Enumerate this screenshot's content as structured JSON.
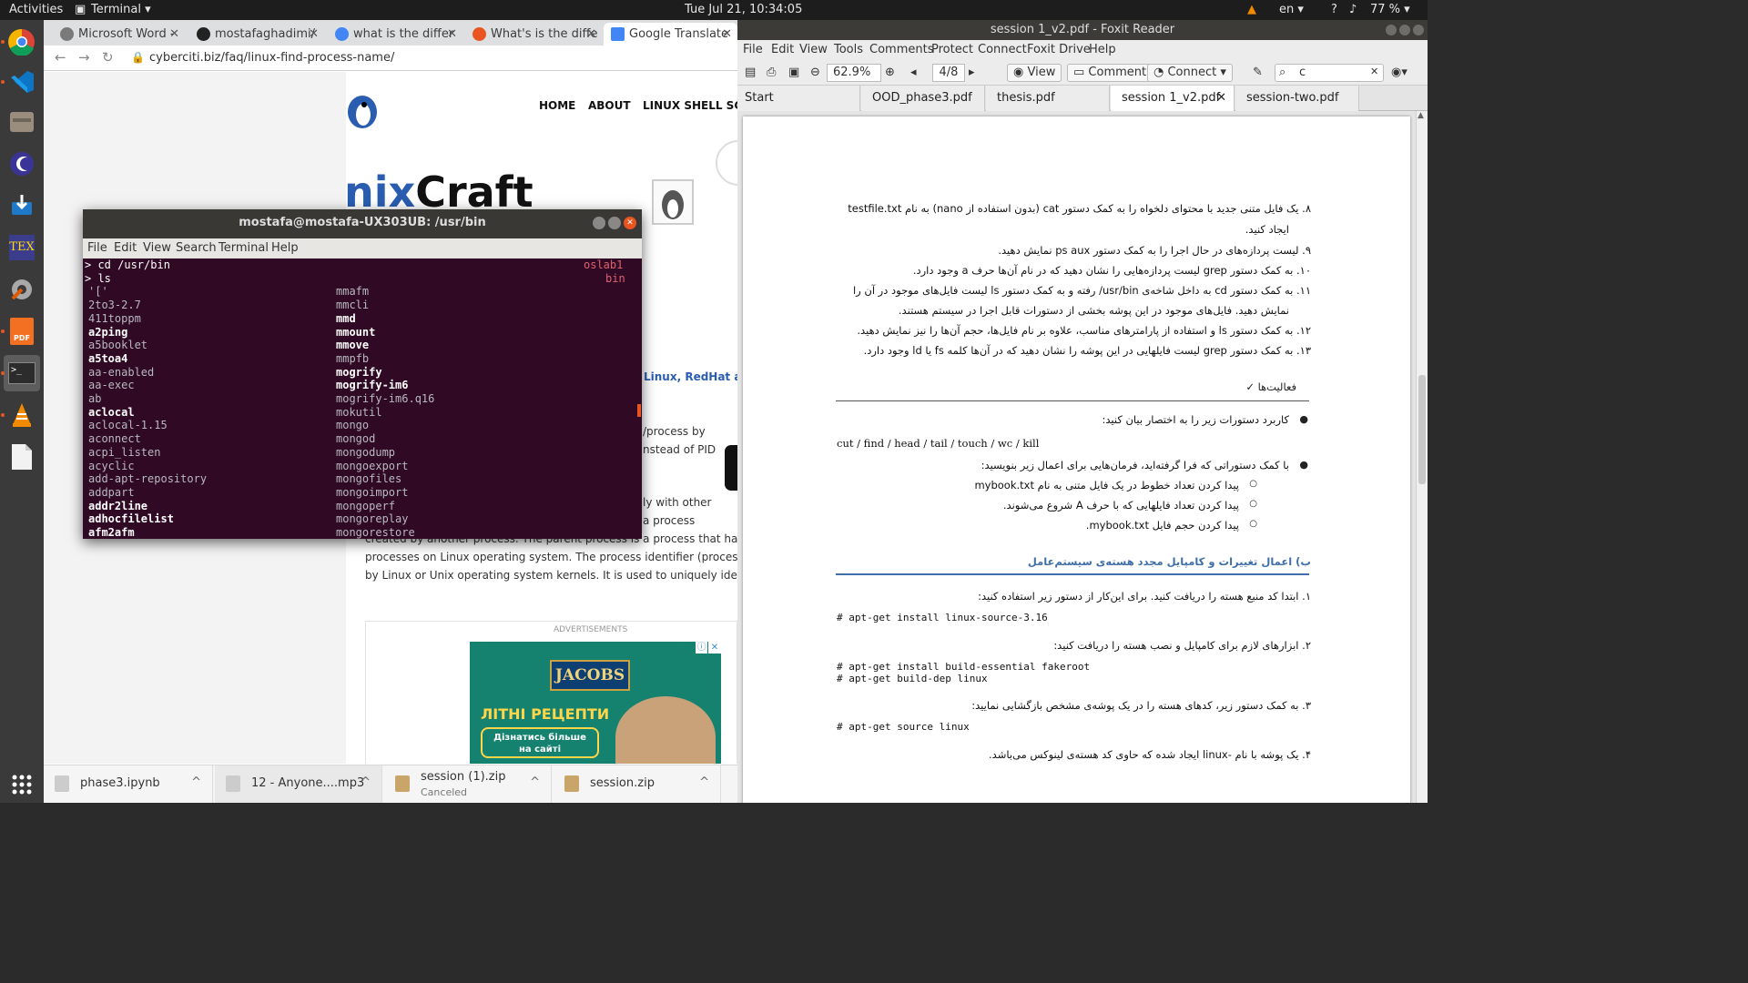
{
  "topbar": {
    "activities": "Activities",
    "app_menu": "Terminal ▾",
    "clock": "Tue Jul 21, 10:34:05",
    "lang": "en ▾",
    "battery": "77 % ▾",
    "help": "?"
  },
  "chrome": {
    "tabs": [
      {
        "label": "Microsoft Word - ",
        "color": "#7a7a7a"
      },
      {
        "label": "mostafaghadimi/",
        "color": "#222222"
      },
      {
        "label": "what is the differ",
        "color": "#4285f4"
      },
      {
        "label": "What's is the diffe",
        "color": "#e95420"
      },
      {
        "label": "Google Translate",
        "color": "#4285f4"
      }
    ],
    "url": "cyberciti.biz/faq/linux-find-process-name/",
    "nav": [
      "HOME",
      "ABOUT",
      "LINUX SHELL SCR"
    ],
    "site_logo_left": "nix",
    "site_logo_right": "Craft",
    "body_lines": [
      "Linux, RedHat and",
      "/process by",
      "nstead of PID",
      "ly with other",
      "a process",
      "created by another process. The parent process is a process that has created on",
      "processes on Linux operating system. The process identifier (process ID or PID)",
      "by Linux or Unix operating system kernels. It is used to uniquely identify an activ"
    ],
    "ads_label": "ADVERTISEMENTS",
    "ad": {
      "brand": "JACOBS",
      "headline": "ЛІТНІ РЕЦЕПТИ",
      "cta": "Дізнатись більше на сайті"
    },
    "downloads": [
      {
        "name": "phase3.ipynb",
        "sub": ""
      },
      {
        "name": "12 - Anyone....mp3",
        "sub": ""
      },
      {
        "name": "session (1).zip",
        "sub": "Canceled"
      },
      {
        "name": "session.zip",
        "sub": ""
      }
    ]
  },
  "terminal": {
    "title": "mostafa@mostafa-UX303UB: /usr/bin",
    "menu": [
      "File",
      "Edit",
      "View",
      "Search",
      "Terminal",
      "Help"
    ],
    "prompt1": "> cd /usr/bin",
    "prompt2": "> ls",
    "right_info1": "oslab1",
    "right_info2": "bin",
    "col1": [
      "'['",
      "2to3-2.7",
      "411toppm",
      "a2ping",
      "a5booklet",
      "a5toa4",
      "aa-enabled",
      "aa-exec",
      "ab",
      "aclocal",
      "aclocal-1.15",
      "aconnect",
      "acpi_listen",
      "acyclic",
      "add-apt-repository",
      "addpart",
      "addr2line",
      "adhocfilelist",
      "afm2afm"
    ],
    "col1_bold": [
      false,
      false,
      false,
      true,
      false,
      true,
      false,
      false,
      false,
      true,
      false,
      false,
      false,
      false,
      false,
      false,
      true,
      true,
      true
    ],
    "col2": [
      "mmafm",
      "mmcli",
      "mmd",
      "mmount",
      "mmove",
      "mmpfb",
      "mogrify",
      "mogrify-im6",
      "mogrify-im6.q16",
      "mokutil",
      "mongo",
      "mongod",
      "mongodump",
      "mongoexport",
      "mongofiles",
      "mongoimport",
      "mongoperf",
      "mongoreplay",
      "mongorestore"
    ],
    "col2_bold": [
      false,
      false,
      true,
      true,
      true,
      false,
      true,
      true,
      false,
      false,
      false,
      false,
      false,
      false,
      false,
      false,
      false,
      false,
      false
    ]
  },
  "foxit": {
    "title": "session 1_v2.pdf - Foxit Reader",
    "menu": [
      "File",
      "Edit",
      "View",
      "Tools",
      "Comments",
      "Protect",
      "Connect",
      "Foxit Drive",
      "Help"
    ],
    "zoom": "62.9%",
    "page": "4/8",
    "view_btn": "View",
    "comment_btn": "Comment",
    "connect_btn": "Connect",
    "search_value": "c",
    "tabs": [
      "Start",
      "OOD_phase3.pdf",
      "thesis.pdf",
      "session 1_v2.pdf",
      "session-two.pdf"
    ],
    "doc": {
      "items_a": [
        "۸. یک فایل متنی جدید با محتوای دلخواه را به کمک دستور cat (بدون استفاده از nano) به نام testfile.txt",
        "ایجاد کنید.",
        "۹. لیست پردازه‌های در حال اجرا را به کمک دستور ps aux نمایش دهید.",
        "۱۰. به کمک دستور grep لیست پردازه‌هایی را نشان دهید که در نام آن‌ها حرف a وجود دارد.",
        "۱۱. به کمک دستور cd به داخل شاخه‌ی usr/bin/ رفته و به کمک دستور ls لیست فایل‌های موجود در آن را",
        "نمایش دهید. فایل‌های موجود در این پوشه بخشی از دستورات قابل اجرا در سیستم هستند.",
        "۱۲. به کمک دستور ls و استفاده از پارامترهای مناسب، علاوه بر نام فایل‌ها، حجم آن‌ها را نیز نمایش دهید.",
        "۱۳. به کمک دستور grep لیست فایلهایی در این پوشه را نشان دهید که در آن‌ها کلمه fs یا ld وجود دارد."
      ],
      "activities_heading": "فعالیت‌ها ✓",
      "bullet1": "کاربرد دستورات زیر را به اختصار بیان کنید:",
      "commands": "cut / find / head / tail / touch / wc / kill",
      "bullet2": "با کمک دستوراتی که فرا گرفته‌اید، فرمان‌هایی برای اعمال زیر بنویسید:",
      "sub": [
        "پیدا کردن تعداد خطوط در یک فایل متنی به نام mybook.txt",
        "پیدا کردن تعداد فایلهایی که با حرف A شروع می‌شوند.",
        "پیدا کردن حجم فایل mybook.txt."
      ],
      "section_b": "ب) اعمال تغییرات و کامپایل مجدد هسته‌ی سیستم‌عامل",
      "step1": "۱. ابتدا کد منبع هسته را دریافت کنید. برای این‌کار از دستور زیر استفاده کنید:",
      "code1": "# apt-get install linux-source-3.16",
      "step2": "۲. ابزارهای لازم برای کامپایل و نصب هسته را دریافت کنید:",
      "code2a": "# apt-get install build-essential fakeroot",
      "code2b": "# apt-get build-dep linux",
      "step3": "۳. به کمک دستور زیر، کدهای هسته را در یک پوشه‌ی مشخص بازگشایی نمایید:",
      "code3": "# apt-get source linux",
      "step4": "۴. یک پوشه با نام            -linux ایجاد شده که حاوی کد هسته‌ی لینوکس می‌باشد."
    }
  }
}
